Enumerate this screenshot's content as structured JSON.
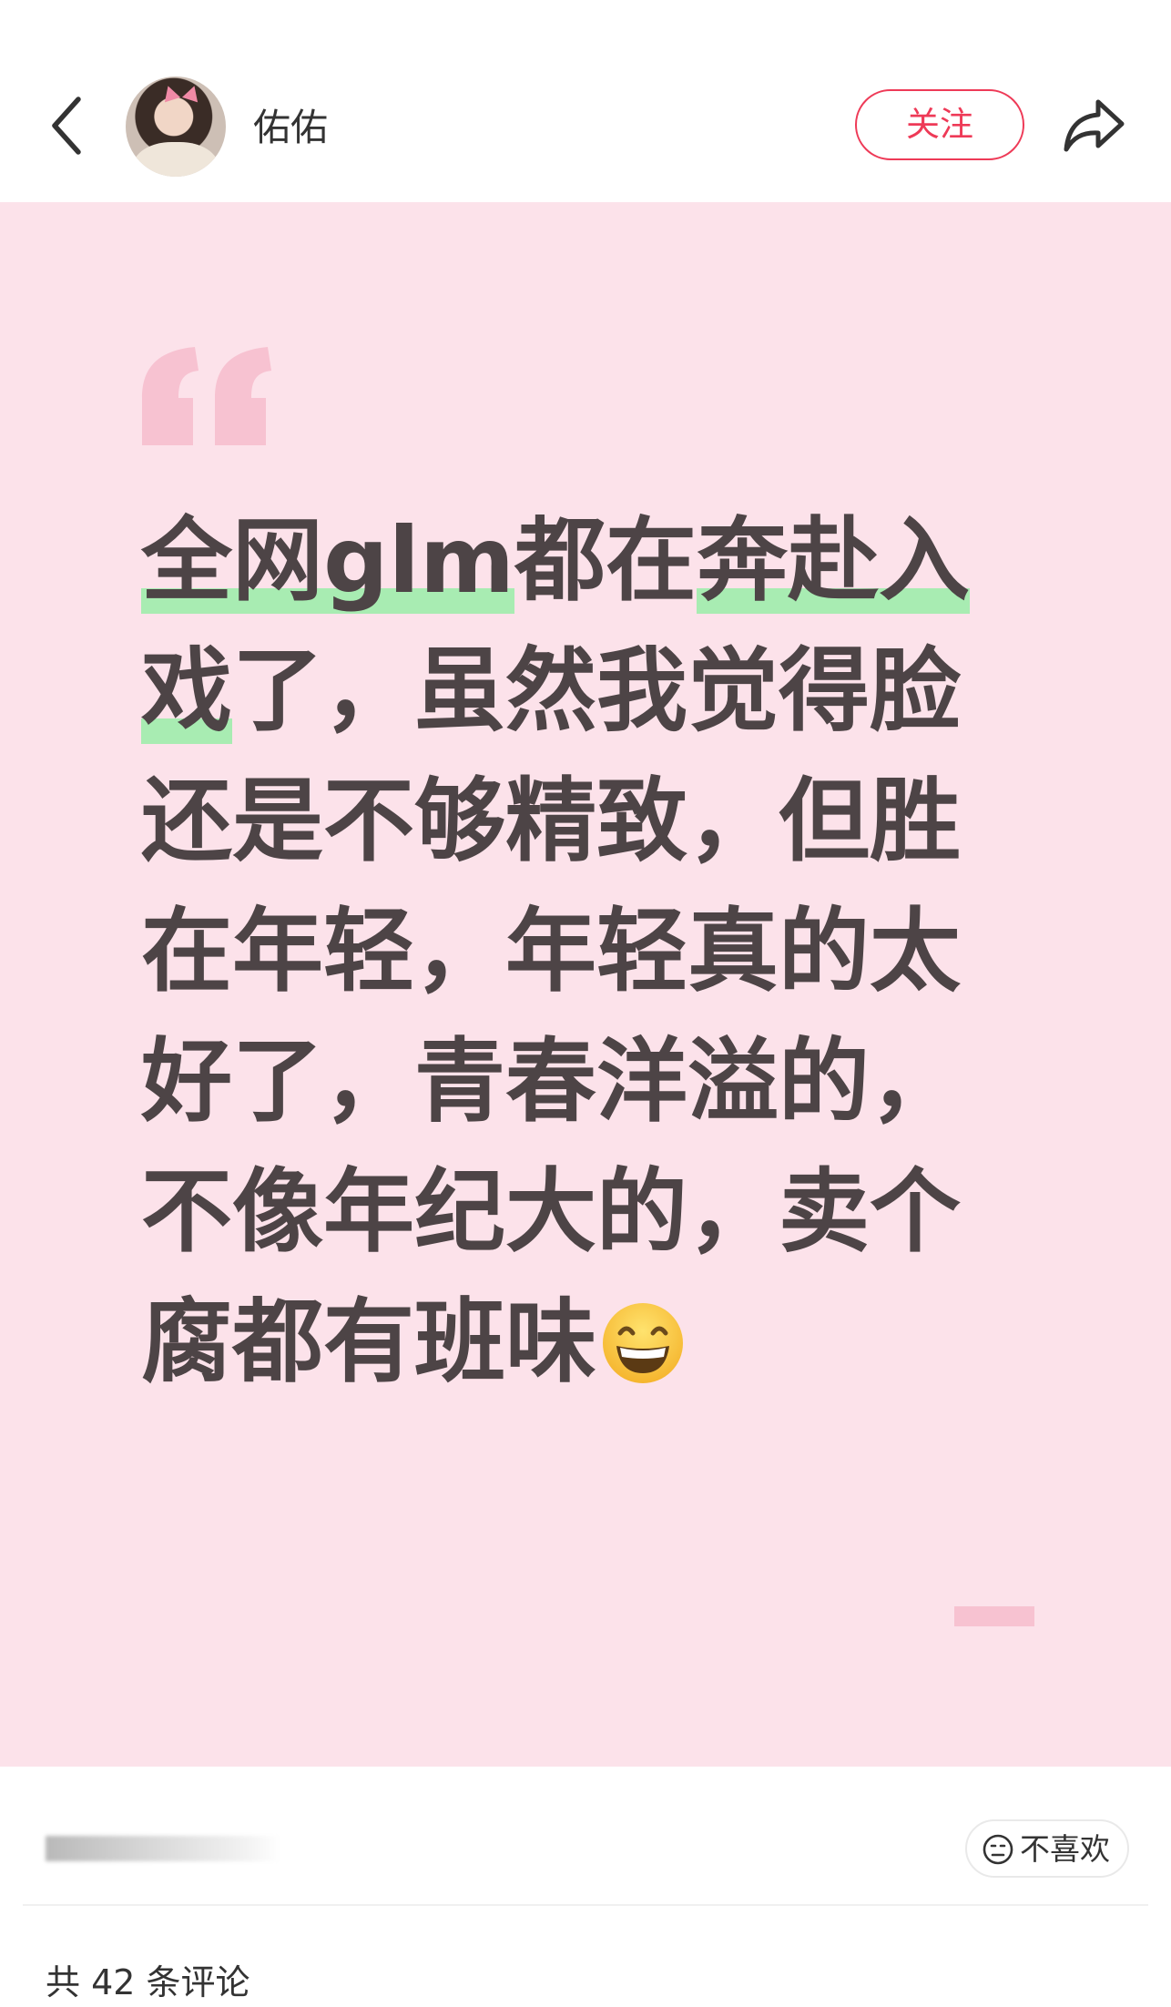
{
  "header": {
    "username": "佑佑",
    "follow_label": "关注"
  },
  "post": {
    "text_segments": [
      {
        "text": "全网glm",
        "highlight": true
      },
      {
        "text": "都在",
        "highlight": false
      },
      {
        "text": "奔赴入",
        "highlight": true
      },
      {
        "text": "戏",
        "highlight": true
      },
      {
        "text": "了，虽然我觉得脸还是不够精致，但胜在年轻，年轻真的太好了，青春洋溢的，不像年纪大的，卖个腐都有班味",
        "highlight": false
      }
    ],
    "emoji": "grinning-face-with-smiling-eyes",
    "highlight_color": "#a8ecb2",
    "background_color": "#fce2ea",
    "text_color": "#4d4446"
  },
  "footer": {
    "dislike_label": "不喜欢",
    "comment_count_text": "共 42 条评论"
  },
  "colors": {
    "accent": "#ee3a57",
    "quote_mark": "#f7c2d1"
  }
}
